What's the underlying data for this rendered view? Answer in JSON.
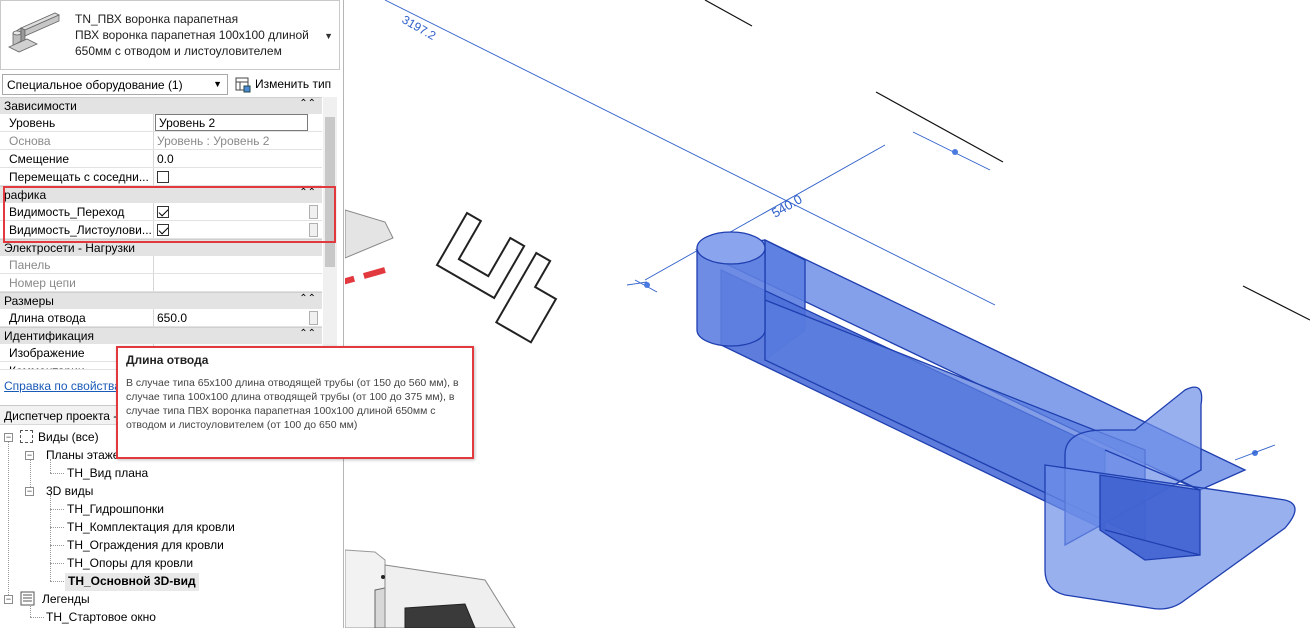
{
  "type_selector": {
    "name": "TN_ПВХ воронка парапетная",
    "description": "ПВХ воронка парапетная 100х100 длиной 650мм с отводом и листоуловителем"
  },
  "category_dropdown": "Специальное оборудование (1)",
  "edit_type_label": "Изменить тип",
  "properties": {
    "constraints": {
      "header": "Зависимости",
      "rows": [
        {
          "label": "Уровень",
          "value": "Уровень 2"
        },
        {
          "label": "Основа",
          "value": "Уровень : Уровень 2"
        },
        {
          "label": "Смещение",
          "value": "0.0"
        },
        {
          "label": "Перемещать с соседни...",
          "value": ""
        }
      ]
    },
    "graphics": {
      "header": "рафика",
      "rows": [
        {
          "label": "Видимость_Переход",
          "checked": true
        },
        {
          "label": "Видимость_Листоулови...",
          "checked": true
        }
      ]
    },
    "electrical": {
      "header": "Электросети - Нагрузки",
      "rows": [
        {
          "label": "Панель",
          "value": ""
        },
        {
          "label": "Номер цепи",
          "value": ""
        }
      ]
    },
    "dimensions": {
      "header": "Размеры",
      "rows": [
        {
          "label": "Длина отвода",
          "value": "650.0"
        }
      ]
    },
    "identity": {
      "header": "Идентификация",
      "rows": [
        {
          "label": "Изображение",
          "value": ""
        },
        {
          "label": "Комментарии",
          "value": ""
        }
      ]
    }
  },
  "help_link": "Справка по свойствам",
  "project_browser": {
    "header": "Диспетчер проекта - ",
    "views_root": "Виды (все)",
    "floor_plans": "Планы этажей",
    "floor_plan_items": [
      "TH_Вид плана"
    ],
    "views_3d": "3D виды",
    "items_3d": [
      "TH_Гидрошпонки",
      "TH_Комплектация для кровли",
      "TH_Ограждения для кровли",
      "TH_Опоры для кровли",
      "TH_Основной 3D-вид"
    ],
    "legends": "Легенды",
    "legend_items": [
      "TH_Стартовое окно"
    ]
  },
  "tooltip": {
    "title": "Длина отвода",
    "body": "В случае типа 65х100 длина отводящей трубы (от 150 до 560 мм), в случае типа 100х100 длина отводящей трубы (от 100 до 375 мм), в случае типа ПВХ воронка парапетная 100х100 длиной 650мм с отводом и листоуловителем (от 100 до 650 мм)"
  },
  "viewport": {
    "dim_top": "3197.2",
    "dim_main": "540.0",
    "colors": {
      "highlight_red": "#e2393e",
      "selection_blue": "#4a6fd8",
      "dimension_blue": "#2e5fc9"
    }
  }
}
